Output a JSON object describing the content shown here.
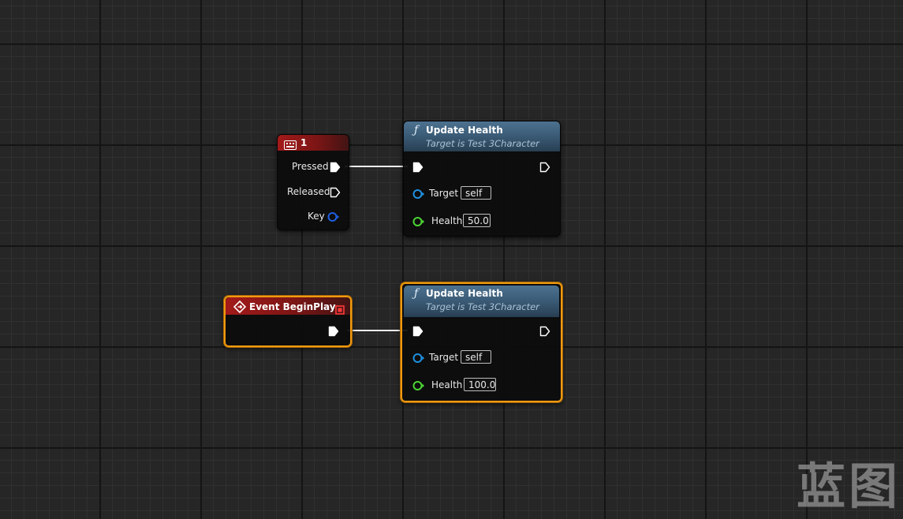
{
  "graph": {
    "nodes": {
      "key_event": {
        "title": "1",
        "icon": "keyboard-icon",
        "pins": {
          "pressed": "Pressed",
          "released": "Released",
          "key": "Key"
        }
      },
      "update_health_1": {
        "title": "Update Health",
        "subtitle": "Target is Test 3Character",
        "icon": "function-icon",
        "target_label": "Target",
        "target_value": "self",
        "health_label": "Health",
        "health_value": "50.0"
      },
      "begin_play": {
        "title": "Event BeginPlay",
        "icon": "event-icon",
        "selected": true
      },
      "update_health_2": {
        "title": "Update Health",
        "subtitle": "Target is Test 3Character",
        "icon": "function-icon",
        "target_label": "Target",
        "target_value": "self",
        "health_label": "Health",
        "health_value": "100.0",
        "selected": true
      }
    },
    "colors": {
      "event_header": "#a31a1a",
      "function_header": "#3a5a75",
      "selection": "#f09a0f",
      "object_pin": "#1e90e0",
      "float_pin": "#4cd434",
      "struct_pin": "#1e5fe0"
    }
  },
  "watermark": "蓝图"
}
